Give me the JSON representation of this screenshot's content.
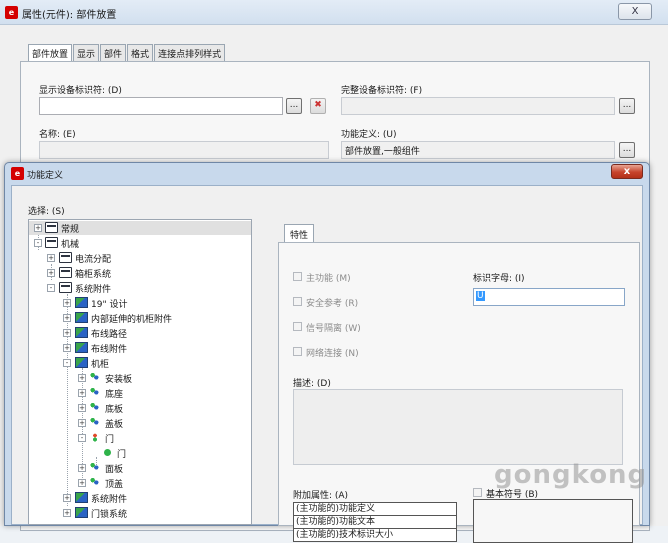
{
  "background_window": {
    "title": "属性(元件): 部件放置",
    "close_label": "X",
    "tabs": [
      "部件放置",
      "显示",
      "部件",
      "格式",
      "连接点排列样式"
    ],
    "display_id_label": "显示设备标识符: (D)",
    "full_id_label": "完整设备标识符: (F)",
    "name_label": "名称: (E)",
    "function_def_label": "功能定义: (U)",
    "function_def_value": "部件放置,一般组件",
    "browse_label": "...",
    "clear_label": "✖"
  },
  "dialog": {
    "title": "功能定义",
    "close_label": "x",
    "selection_label": "选择: (S)",
    "tree": [
      {
        "label": "常规",
        "level": 0,
        "expander": "+",
        "icon": "folder-icon",
        "selected": true
      },
      {
        "label": "机械",
        "level": 0,
        "expander": "-",
        "icon": "folder-icon"
      },
      {
        "label": "电流分配",
        "level": 1,
        "expander": "+",
        "icon": "folder-icon"
      },
      {
        "label": "箱柜系统",
        "level": 1,
        "expander": "+",
        "icon": "folder-icon"
      },
      {
        "label": "系统附件",
        "level": 1,
        "expander": "-",
        "icon": "folder-icon"
      },
      {
        "label": "19\" 设计",
        "level": 2,
        "expander": "+",
        "icon": "component-icon"
      },
      {
        "label": "内部延伸的机柜附件",
        "level": 2,
        "expander": "+",
        "icon": "component-icon"
      },
      {
        "label": "布线路径",
        "level": 2,
        "expander": "+",
        "icon": "component-icon"
      },
      {
        "label": "布线附件",
        "level": 2,
        "expander": "+",
        "icon": "component-icon"
      },
      {
        "label": "机柜",
        "level": 2,
        "expander": "-",
        "icon": "component-icon"
      },
      {
        "label": "安装板",
        "level": 3,
        "expander": "+",
        "icon": "part-icon"
      },
      {
        "label": "底座",
        "level": 3,
        "expander": "+",
        "icon": "part-icon"
      },
      {
        "label": "底板",
        "level": 3,
        "expander": "+",
        "icon": "part-icon"
      },
      {
        "label": "盖板",
        "level": 3,
        "expander": "+",
        "icon": "part-icon"
      },
      {
        "label": "门",
        "level": 3,
        "expander": "-",
        "icon": "door-icon"
      },
      {
        "label": "门",
        "level": 4,
        "expander": "",
        "icon": "green-dot-icon"
      },
      {
        "label": "面板",
        "level": 3,
        "expander": "+",
        "icon": "part-icon"
      },
      {
        "label": "顶盖",
        "level": 3,
        "expander": "+",
        "icon": "part-icon"
      },
      {
        "label": "系统附件",
        "level": 2,
        "expander": "+",
        "icon": "component-icon"
      },
      {
        "label": "门锁系统",
        "level": 2,
        "expander": "+",
        "icon": "component-icon"
      }
    ],
    "properties_tab": "特性",
    "checkboxes": [
      {
        "label": "主功能 (M)",
        "checked": false
      },
      {
        "label": "安全参考 (R)",
        "checked": false
      },
      {
        "label": "信号隔离 (W)",
        "checked": false
      },
      {
        "label": "网络连接 (N)",
        "checked": false
      }
    ],
    "id_letter_label": "标识字母: (I)",
    "id_letter_value": "U",
    "description_label": "描述: (D)",
    "extra_props_label": "附加属性: (A)",
    "extra_props": [
      "(主功能的)功能定义",
      "(主功能的)功能文本",
      "(主功能的)技术标识大小"
    ],
    "basic_symbol_label": "基本符号 (B)",
    "basic_symbol_checked": false
  },
  "watermark": "gongkong"
}
